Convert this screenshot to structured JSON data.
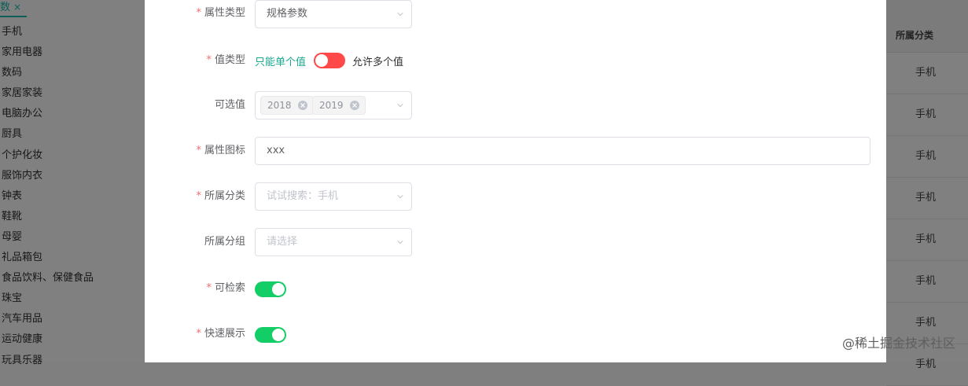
{
  "background": {
    "tab_label": "数",
    "tab_close": "×",
    "tree_items": [
      "手机",
      "家用电器",
      "数码",
      "家居家装",
      "电脑办公",
      "厨具",
      "个护化妆",
      "服饰内衣",
      "钟表",
      "鞋靴",
      "母婴",
      "礼品箱包",
      "食品饮料、保健食品",
      "珠宝",
      "汽车用品",
      "运动健康",
      "玩具乐器"
    ],
    "table_header": "所属分类",
    "table_cells": [
      "手机",
      "手机",
      "手机",
      "手机",
      "手机",
      "手机",
      "手机",
      "手机"
    ]
  },
  "form": {
    "attr_type": {
      "label": "属性类型",
      "value": "规格参数"
    },
    "value_type": {
      "label": "值类型",
      "single_label": "只能单个值",
      "multi_label": "允许多个值",
      "multi_enabled": false
    },
    "options": {
      "label": "可选值",
      "tags": [
        "2018",
        "2019"
      ]
    },
    "attr_icon": {
      "label": "属性图标",
      "value": "xxx"
    },
    "category": {
      "label": "所属分类",
      "placeholder": "试试搜索：手机"
    },
    "group": {
      "label": "所属分组",
      "placeholder": "请选择"
    },
    "searchable": {
      "label": "可检索",
      "enabled": true
    },
    "quick_show": {
      "label": "快速展示",
      "enabled": true
    },
    "required_mark": "*"
  },
  "watermark": "@稀土掘金技术社区",
  "colors": {
    "switch_on": "#13ce66",
    "switch_off": "#ff4949",
    "required": "#f56c6c",
    "accent": "#0c5e58"
  }
}
